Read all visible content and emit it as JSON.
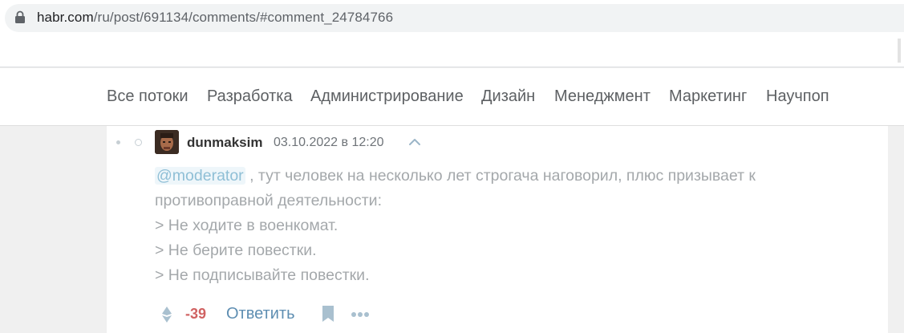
{
  "browser": {
    "url_host": "habr.com",
    "url_path": "/ru/post/691134/comments/#comment_24784766"
  },
  "nav": {
    "items": [
      "Все потоки",
      "Разработка",
      "Администрирование",
      "Дизайн",
      "Менеджмент",
      "Маркетинг",
      "Научпоп"
    ]
  },
  "comment": {
    "author": "dunmaksim",
    "timestamp": "03.10.2022 в 12:20",
    "mention": "@moderator",
    "lines": [
      " , тут человек на несколько лет строгача наговорил, плюс призывает к противоправной деятельности:",
      "> Не ходите в военкомат.",
      "> Не берите повестки.",
      "> Не подписывайте повестки."
    ],
    "score": "-39",
    "reply_label": "Ответить"
  },
  "colors": {
    "score_negative": "#d06262",
    "reply_link": "#5e8eb2",
    "mention_bg": "#eef6fa"
  }
}
